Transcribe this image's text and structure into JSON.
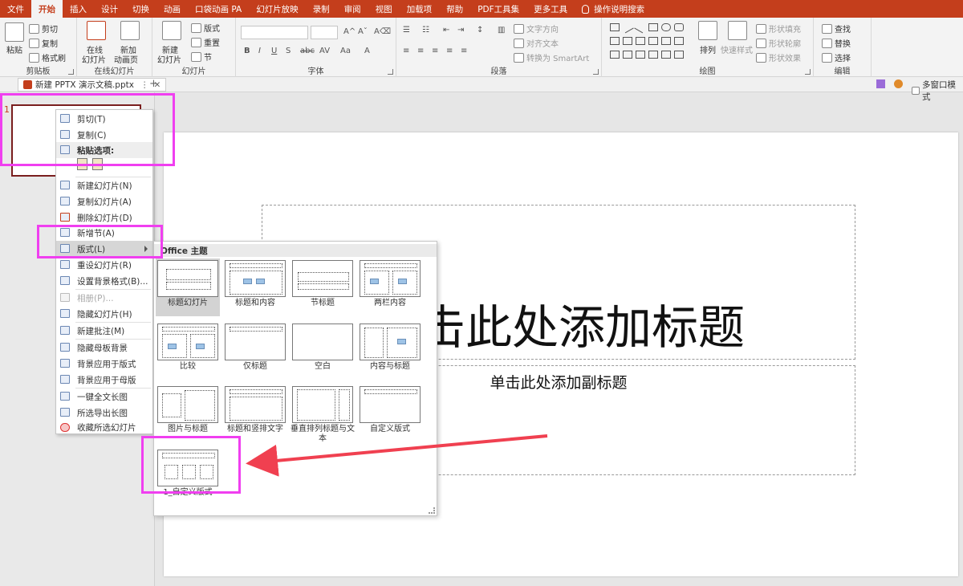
{
  "tabs": [
    "文件",
    "开始",
    "插入",
    "设计",
    "切换",
    "动画",
    "口袋动画 PA",
    "幻灯片放映",
    "录制",
    "审阅",
    "视图",
    "加载项",
    "帮助",
    "PDF工具集",
    "更多工具",
    "操作说明搜索"
  ],
  "ribbon": {
    "clipboard": {
      "paste": "粘贴",
      "cut": "剪切",
      "copy": "复制",
      "format_painter": "格式刷",
      "label": "剪贴板"
    },
    "online_slides": {
      "online": "在线",
      "online2": "幻灯片",
      "add": "新加",
      "add2": "动画页",
      "label": "在线幻灯片"
    },
    "slides": {
      "new": "新建",
      "new2": "幻灯片",
      "layout": "版式",
      "reset": "重置",
      "section": "节",
      "label": "幻灯片"
    },
    "font": {
      "label": "字体"
    },
    "paragraph": {
      "text_direction": "文字方向",
      "align_text": "对齐文本",
      "smartart": "转换为 SmartArt",
      "label": "段落"
    },
    "drawing": {
      "arrange": "排列",
      "quick_styles": "快速样式",
      "fill": "形状填充",
      "outline": "形状轮廓",
      "effects": "形状效果",
      "label": "绘图"
    },
    "editing": {
      "find": "查找",
      "replace": "替换",
      "select": "选择",
      "label": "编辑"
    }
  },
  "doc": {
    "tab_title": "新建 PPTX 演示文稿.pptx",
    "multi_window": "多窗口模式"
  },
  "slide": {
    "number": "1",
    "title": "单击此处添加标题",
    "subtitle": "单击此处添加副标题"
  },
  "context_menu": {
    "cut": "剪切(T)",
    "copy": "复制(C)",
    "paste_options": "粘贴选项:",
    "new_slide": "新建幻灯片(N)",
    "duplicate": "复制幻灯片(A)",
    "delete": "删除幻灯片(D)",
    "add_section": "新增节(A)",
    "layout": "版式(L)",
    "reset": "重设幻灯片(R)",
    "format_background": "设置背景格式(B)...",
    "album": "相册(P)...",
    "hide": "隐藏幻灯片(H)",
    "new_comment": "新建批注(M)",
    "hide_master_bg": "隐藏母板背景",
    "apply_bg_layout": "背景应用于版式",
    "apply_bg_master": "背景应用于母版",
    "one_click_long": "一键全文长图",
    "export_long": "所选导出长图",
    "favorite": "收藏所选幻灯片"
  },
  "layout_menu": {
    "header": "Office 主题",
    "items": [
      "标题幻灯片",
      "标题和内容",
      "节标题",
      "两栏内容",
      "比较",
      "仅标题",
      "空白",
      "内容与标题",
      "图片与标题",
      "标题和竖排文字",
      "垂直排列标题与文本",
      "自定义版式",
      "1_自定义版式"
    ]
  },
  "colors": {
    "accent": "#c43e1c",
    "highlight": "#f03ff0",
    "arrow": "#f04050"
  }
}
